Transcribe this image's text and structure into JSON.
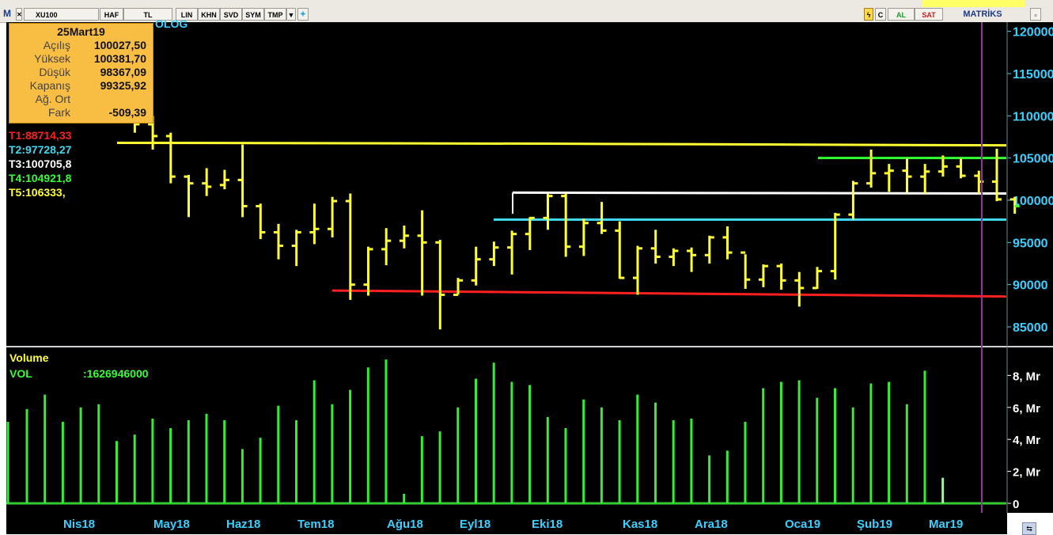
{
  "toolbar": {
    "logo": "M",
    "symbol": "XU100",
    "buttons": [
      "HAF",
      "TL",
      "LIN",
      "KHN",
      "SVD",
      "SYM",
      "TMP"
    ],
    "buy_label": "AL",
    "sell_label": "SAT",
    "brand": "MATRİKS",
    "colors": {
      "buy": "#1a9b2e",
      "sell": "#c81e1e"
    }
  },
  "info_box": {
    "date": "25Mart19",
    "rows": [
      {
        "label": "Açılış",
        "value": "100027,50"
      },
      {
        "label": "Yüksek",
        "value": "100381,70"
      },
      {
        "label": "Düşük",
        "value": "98367,09"
      },
      {
        "label": "Kapanış",
        "value": "99325,92"
      },
      {
        "label": "Ağ. Ort",
        "value": ""
      },
      {
        "label": "Fark",
        "value": "-509,39"
      }
    ]
  },
  "title_fragment": "OLOG",
  "targets": [
    {
      "label": "T1:88714,33",
      "color": "#ff2020"
    },
    {
      "label": "T2:97728,27",
      "color": "#40d8f0"
    },
    {
      "label": "T3:100705,8",
      "color": "#ffffff"
    },
    {
      "label": "T4:104921,8",
      "color": "#33ff33"
    },
    {
      "label": "T5:106333,",
      "color": "#ffff33"
    }
  ],
  "volume": {
    "title": "Volume",
    "indicator": "VOL",
    "value": ":1626946000"
  },
  "chart_data": {
    "type": "bar",
    "subtype": "ohlc",
    "price_axis": {
      "ticks": [
        85000,
        90000,
        95000,
        100000,
        105000,
        110000,
        115000,
        120000
      ],
      "tick_labels": [
        "85000",
        "90000",
        "95000",
        "100000",
        "105000",
        "110000",
        "115000",
        "120000"
      ],
      "ylim": [
        82000,
        121500
      ]
    },
    "volume_axis": {
      "ticks": [
        0,
        2,
        4,
        6,
        8
      ],
      "tick_labels": [
        "0",
        "2, Mr",
        "4, Mr",
        "6, Mr",
        "8, Mr"
      ],
      "ylim": [
        0,
        9
      ]
    },
    "x_labels": [
      "Nis18",
      "May18",
      "Haz18",
      "Tem18",
      "Ağu18",
      "Eyl18",
      "Eki18",
      "Kas18",
      "Ara18",
      "Oca19",
      "Şub19",
      "Mar19"
    ],
    "ohlc": [
      [
        null,
        113800,
        112500,
        null
      ],
      [
        111000,
        112600,
        109500,
        110000
      ],
      [
        110800,
        111500,
        108000,
        109000
      ],
      [
        109000,
        110000,
        106000,
        107600
      ],
      [
        107600,
        108000,
        102000,
        102800
      ],
      [
        102800,
        103000,
        98000,
        102000
      ],
      [
        102000,
        103800,
        100500,
        101600
      ],
      [
        101800,
        103600,
        101300,
        102400
      ],
      [
        102400,
        106600,
        98000,
        99300
      ],
      [
        99300,
        99600,
        95400,
        96200
      ],
      [
        96200,
        97200,
        93000,
        94600
      ],
      [
        94600,
        96500,
        92200,
        96200
      ],
      [
        96200,
        99600,
        94800,
        96600
      ],
      [
        96600,
        100400,
        95600,
        99900
      ],
      [
        99900,
        100800,
        88200,
        90000
      ],
      [
        90000,
        94500,
        88700,
        94200
      ],
      [
        94200,
        96700,
        92300,
        95200
      ],
      [
        95200,
        97000,
        94300,
        95800
      ],
      [
        95800,
        98800,
        88700,
        95000
      ],
      [
        95000,
        95300,
        84700,
        88800
      ],
      [
        88800,
        90800,
        88800,
        90500
      ],
      [
        90500,
        94500,
        89900,
        93000
      ],
      [
        93000,
        95100,
        92200,
        94400
      ],
      [
        94400,
        96400,
        91200,
        96000
      ],
      [
        96000,
        98000,
        94100,
        97900
      ],
      [
        97900,
        100800,
        96500,
        100500
      ],
      [
        100500,
        100800,
        93300,
        94500
      ],
      [
        94500,
        97800,
        93400,
        97300
      ],
      [
        97300,
        99800,
        96000,
        96400
      ],
      [
        96400,
        97500,
        90700,
        90800
      ],
      [
        90800,
        94600,
        88800,
        94300
      ],
      [
        94300,
        96500,
        92500,
        93300
      ],
      [
        93300,
        94300,
        92200,
        94000
      ],
      [
        94000,
        94400,
        91500,
        93500
      ],
      [
        93500,
        95800,
        92500,
        95600
      ],
      [
        95600,
        96900,
        93000,
        93800
      ],
      [
        93800,
        93600,
        89500,
        90600
      ],
      [
        90600,
        92400,
        89700,
        92200
      ],
      [
        92200,
        92500,
        89400,
        90500
      ],
      [
        90500,
        91500,
        87400,
        89600
      ],
      [
        89600,
        92100,
        89500,
        91600
      ],
      [
        91600,
        98500,
        90600,
        98300
      ],
      [
        98300,
        102300,
        97700,
        102000
      ],
      [
        102000,
        106000,
        101500,
        103200
      ],
      [
        103200,
        104300,
        101000,
        103500
      ],
      [
        103500,
        105000,
        100900,
        102800
      ],
      [
        102800,
        104300,
        100800,
        103400
      ],
      [
        103400,
        105300,
        102800,
        104000
      ],
      [
        104000,
        105000,
        102600,
        102900
      ],
      [
        102900,
        103500,
        100800,
        102200
      ],
      [
        102200,
        106100,
        99900,
        100100
      ],
      [
        100100,
        100400,
        98400,
        99300
      ]
    ],
    "volume_values": [
      5.9,
      6.8,
      5.1,
      6.0,
      6.2,
      3.9,
      4.3,
      5.3,
      4.7,
      5.2,
      5.6,
      5.2,
      3.4,
      4.1,
      6.1,
      5.2,
      7.7,
      6.2,
      7.1,
      8.5,
      9.0,
      0.6,
      4.2,
      4.5,
      6.0,
      7.8,
      8.8,
      7.6,
      7.4,
      5.4,
      4.7,
      6.5,
      6.0,
      5.2,
      6.8,
      6.3,
      5.2,
      5.3,
      3.0,
      3.3,
      5.1,
      7.2,
      7.6,
      7.7,
      6.6,
      7.2,
      6.0,
      7.5,
      7.6,
      6.2,
      8.3,
      1.6
    ],
    "trend_lines": [
      {
        "color": "#ffff33",
        "segments": [
          [
            106800,
            106700
          ],
          [
            106700,
            106500
          ]
        ]
      },
      {
        "color": "#ffffff",
        "segments": [
          [
            100900,
            100800
          ]
        ]
      },
      {
        "color": "#40d8f0",
        "value": 97700
      },
      {
        "color": "#33ff33",
        "value": 105000
      },
      {
        "color": "#ff2020",
        "segments": [
          [
            89300,
            88600
          ]
        ]
      }
    ]
  }
}
